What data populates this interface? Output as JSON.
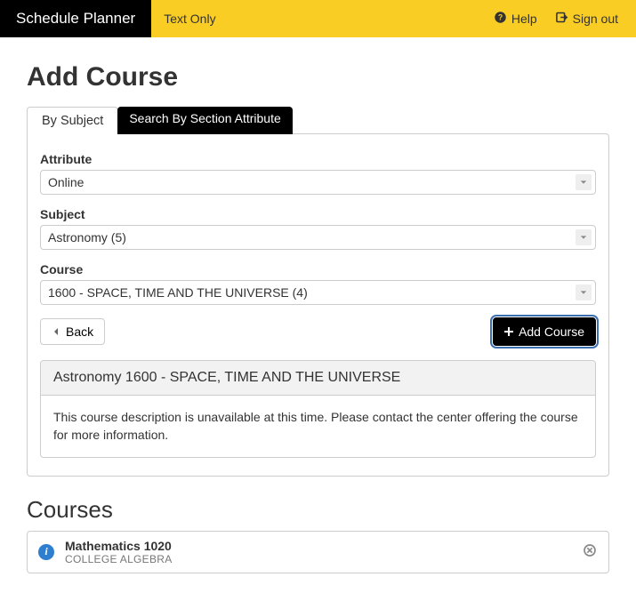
{
  "header": {
    "brand": "Schedule Planner",
    "text_only": "Text Only",
    "help": "Help",
    "sign_out": "Sign out"
  },
  "page": {
    "title": "Add Course"
  },
  "tabs": {
    "by_subject": "By Subject",
    "by_attribute": "Search By Section Attribute"
  },
  "form": {
    "attribute_label": "Attribute",
    "attribute_value": "Online",
    "subject_label": "Subject",
    "subject_value": "Astronomy (5)",
    "course_label": "Course",
    "course_value": "1600 - SPACE, TIME AND THE UNIVERSE (4)"
  },
  "actions": {
    "back": "Back",
    "add_course": "Add Course"
  },
  "detail": {
    "title": "Astronomy 1600 - SPACE, TIME AND THE UNIVERSE",
    "description": "This course description is unavailable at this time. Please contact the center offering the course for more information."
  },
  "courses_section": {
    "heading": "Courses",
    "items": [
      {
        "title": "Mathematics 1020",
        "subtitle": "COLLEGE ALGEBRA"
      }
    ]
  }
}
